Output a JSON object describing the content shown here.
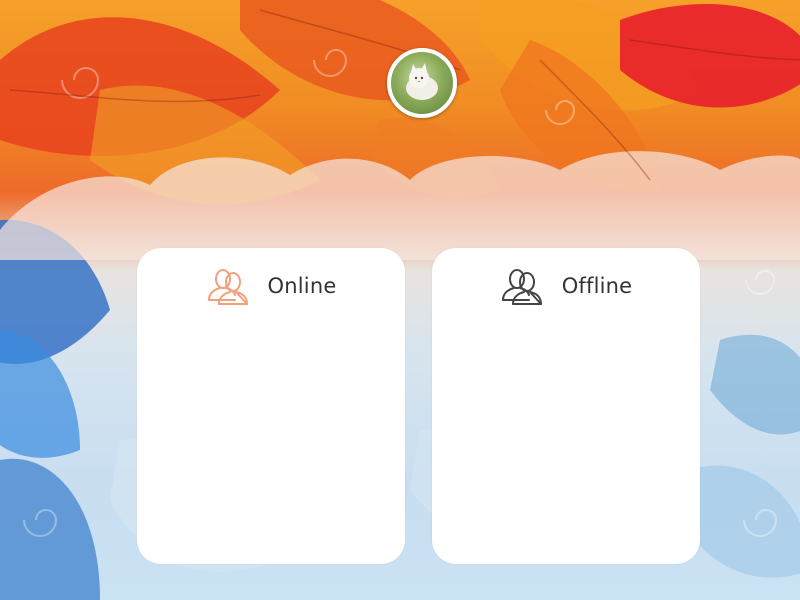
{
  "panels": {
    "online": {
      "title": "Online",
      "icon": "users-icon",
      "icon_color": "#f2a07a"
    },
    "offline": {
      "title": "Offline",
      "icon": "users-icon",
      "icon_color": "#444444"
    }
  },
  "avatar": {
    "icon": "cat-avatar"
  }
}
